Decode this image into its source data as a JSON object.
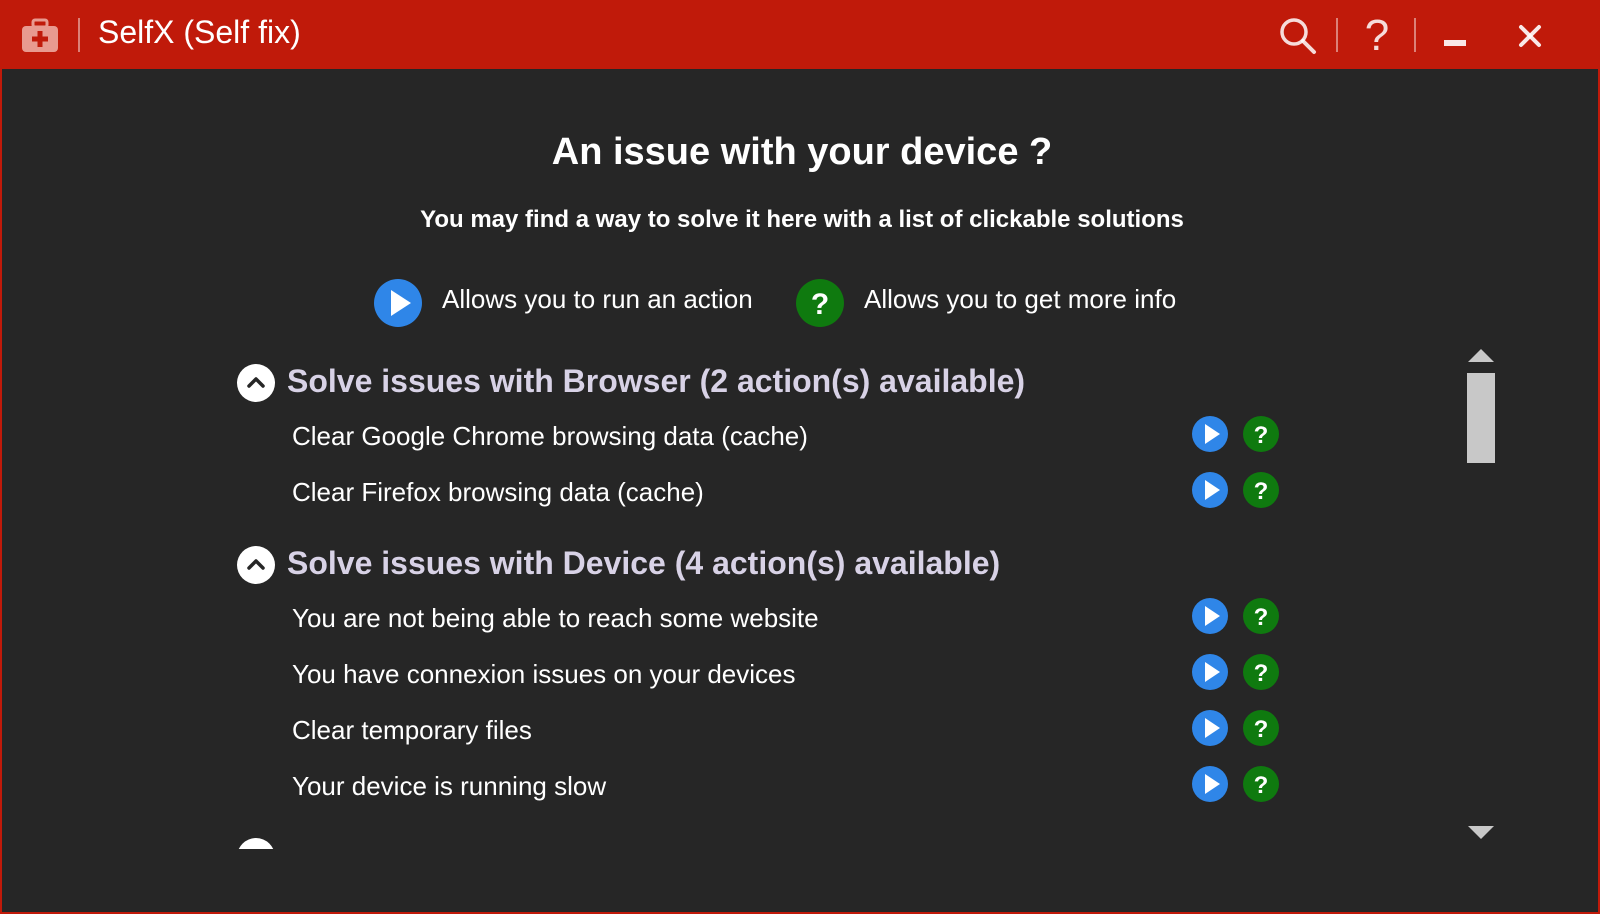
{
  "window": {
    "title": "SelfX (Self fix)",
    "accent_color": "#c01a0a",
    "background_color": "#262626",
    "titlebar_buttons": {
      "search_icon": "search-icon",
      "help_label": "?",
      "minimize_icon": "minimize-icon",
      "close_icon": "close-icon"
    }
  },
  "header": {
    "title": "An issue with your device ?",
    "subtitle": "You may find a way to solve it here with a list of clickable solutions"
  },
  "legend": {
    "run_text": "Allows you to run an action",
    "info_text": "Allows you to get more info",
    "run_color": "#2f86e8",
    "info_color": "#0f7a0f"
  },
  "sections": [
    {
      "title": "Solve issues with Browser (2 action(s) available)",
      "actions": [
        {
          "label": "Clear Google Chrome browsing data (cache)"
        },
        {
          "label": "Clear Firefox browsing data (cache)"
        }
      ]
    },
    {
      "title": "Solve issues with Device (4 action(s) available)",
      "actions": [
        {
          "label": "You are not being able to reach some website"
        },
        {
          "label": "You have connexion issues on your devices"
        },
        {
          "label": "Clear temporary files"
        },
        {
          "label": "Your device is running slow"
        }
      ]
    }
  ]
}
